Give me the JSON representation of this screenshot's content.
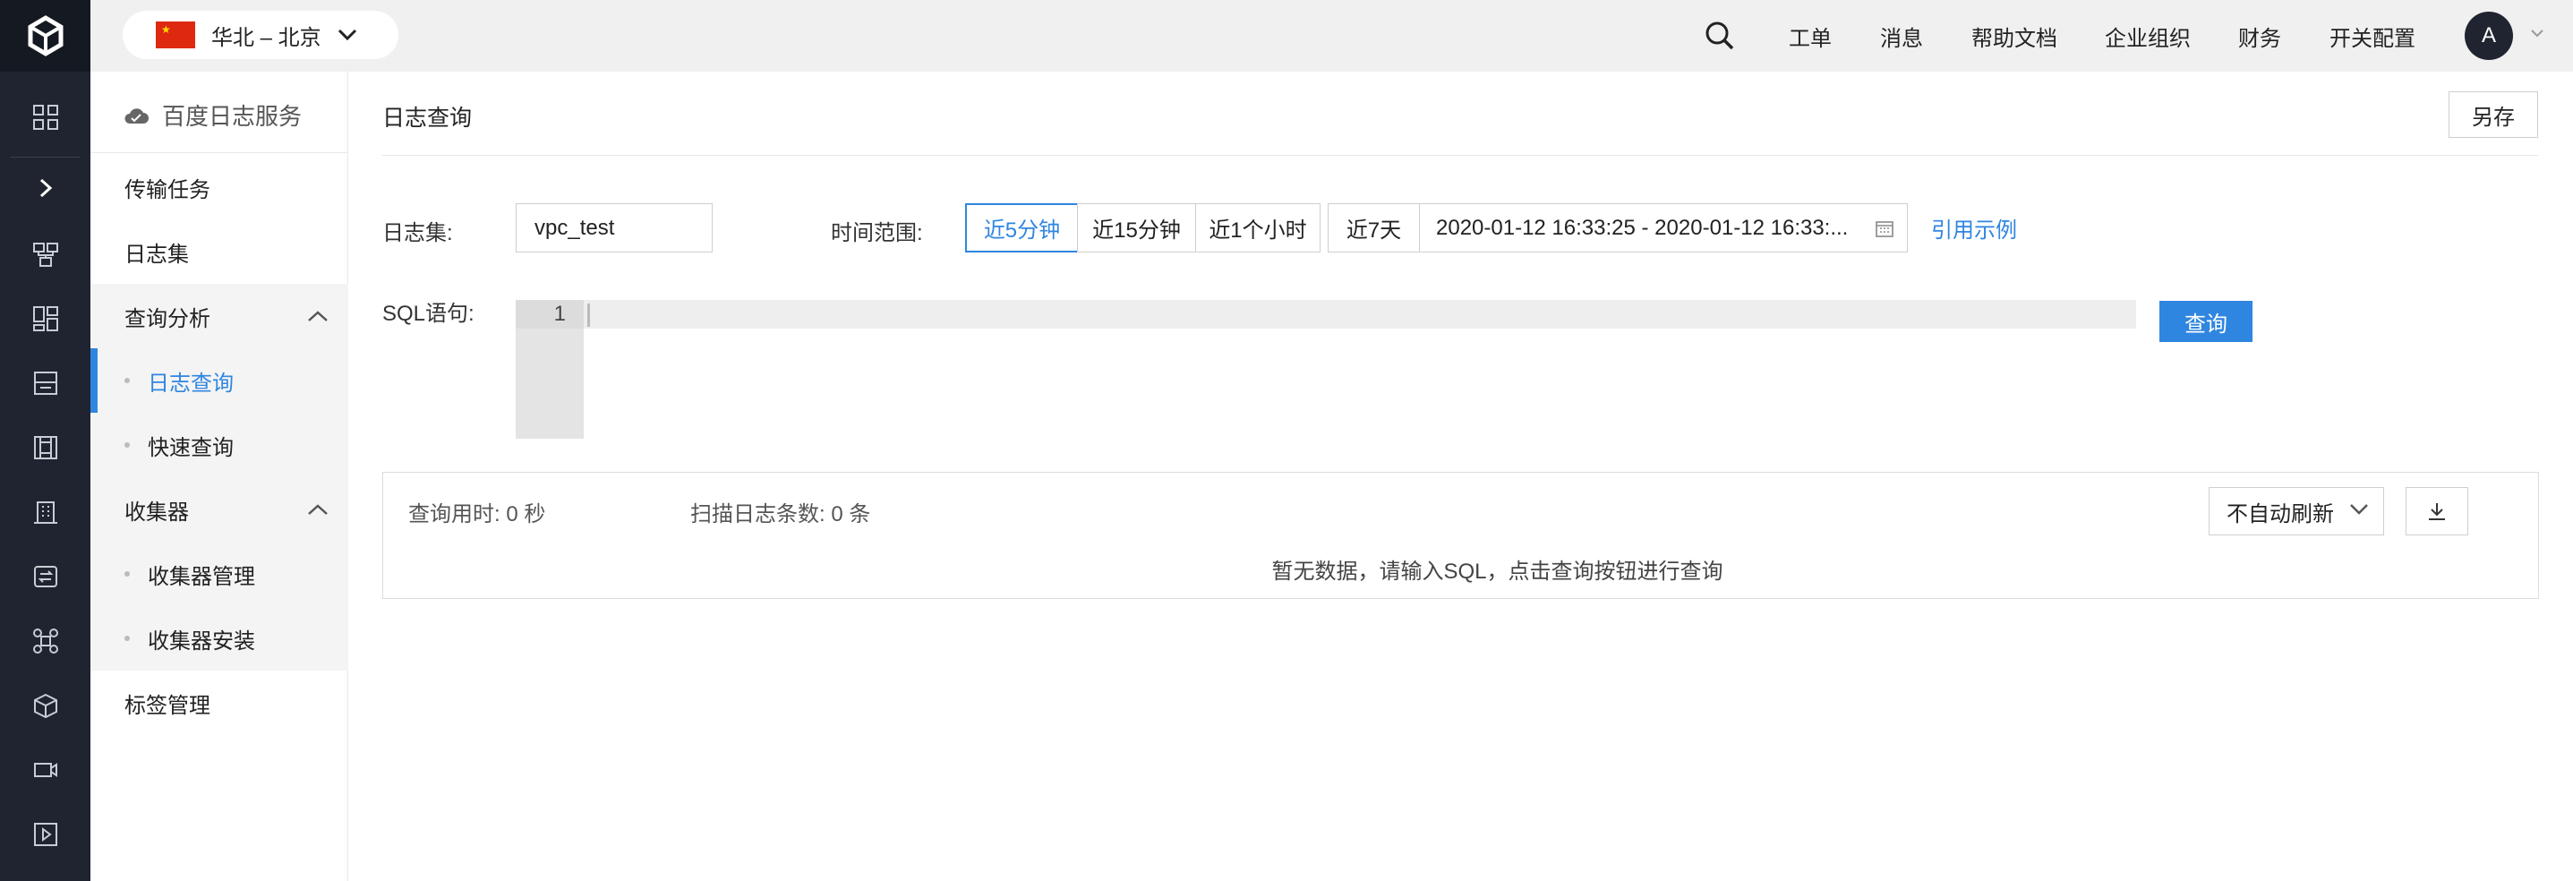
{
  "topbar": {
    "region": "华北 – 北京",
    "nav": [
      "工单",
      "消息",
      "帮助文档",
      "企业组织",
      "财务",
      "开关配置"
    ],
    "avatar_letter": "A"
  },
  "sidebar": {
    "service_title": "百度日志服务",
    "items": [
      {
        "label": "传输任务"
      },
      {
        "label": "日志集"
      },
      {
        "label": "查询分析"
      },
      {
        "label": "日志查询"
      },
      {
        "label": "快速查询"
      },
      {
        "label": "收集器"
      },
      {
        "label": "收集器管理"
      },
      {
        "label": "收集器安装"
      },
      {
        "label": "标签管理"
      }
    ]
  },
  "main": {
    "title": "日志查询",
    "save_label": "另存",
    "logset_label": "日志集:",
    "logset_value": "vpc_test",
    "time_label": "时间范围:",
    "time_options": [
      "近5分钟",
      "近15分钟",
      "近1个小时",
      "近7天"
    ],
    "active_time_option": "近5分钟",
    "date_range": "2020-01-12 16:33:25 - 2020-01-12 16:33:...",
    "example_link": "引用示例",
    "sql_label": "SQL语句:",
    "line_number": "1",
    "query_button": "查询",
    "result": {
      "time_used": "查询用时: 0 秒",
      "scanned": "扫描日志条数: 0 条",
      "refresh": "不自动刷新",
      "empty": "暂无数据，请输入SQL，点击查询按钮进行查询"
    }
  }
}
